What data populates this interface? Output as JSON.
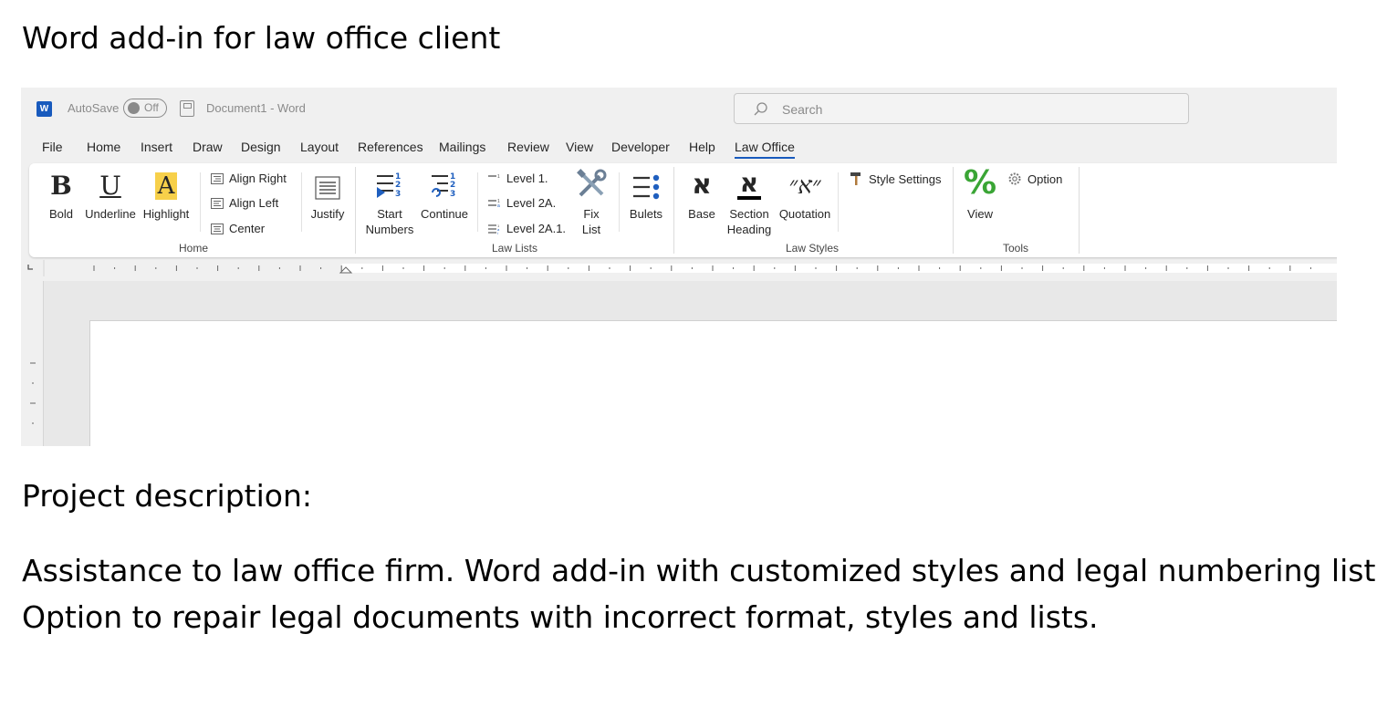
{
  "heading": "Word add-in for law office client",
  "project_heading": "Project description:",
  "description_lines": [
    "Assistance to law office firm. Word add-in with customized styles and legal numbering lists.",
    "Option to repair legal documents with  incorrect format, styles and lists."
  ],
  "word": {
    "autosave_label": "AutoSave",
    "toggle_state": "Off",
    "doc_title": "Document1  -  Word",
    "search_placeholder": "Search",
    "menu": [
      "File",
      "Home",
      "Insert",
      "Draw",
      "Design",
      "Layout",
      "References",
      "Mailings",
      "Review",
      "View",
      "Developer",
      "Help",
      "Law Office"
    ],
    "active_tab": "Law Office",
    "accent_color": "#185abd",
    "ribbon": {
      "home": {
        "bold": "Bold",
        "underline": "Underline",
        "highlight": "Highlight",
        "align_right": "Align Right",
        "align_left": "Align Left",
        "center": "Center",
        "justify": "Justify",
        "label": "Home"
      },
      "law_lists": {
        "start_line1": "Start",
        "start_line2": "Numbers",
        "continue": "Continue",
        "level1": "Level 1.",
        "level2a": "Level 2A.",
        "level2a1": "Level 2A.1.",
        "fix_line1": "Fix",
        "fix_line2": "List",
        "bulets": "Bulets",
        "label": "Law Lists"
      },
      "law_styles": {
        "base": "Base",
        "section_line1": "Section",
        "section_line2": "Heading",
        "quotation": "Quotation",
        "style_settings": "Style Settings",
        "label": "Law Styles"
      },
      "tools": {
        "view": "View",
        "option": "Option",
        "label": "Tools"
      }
    }
  }
}
